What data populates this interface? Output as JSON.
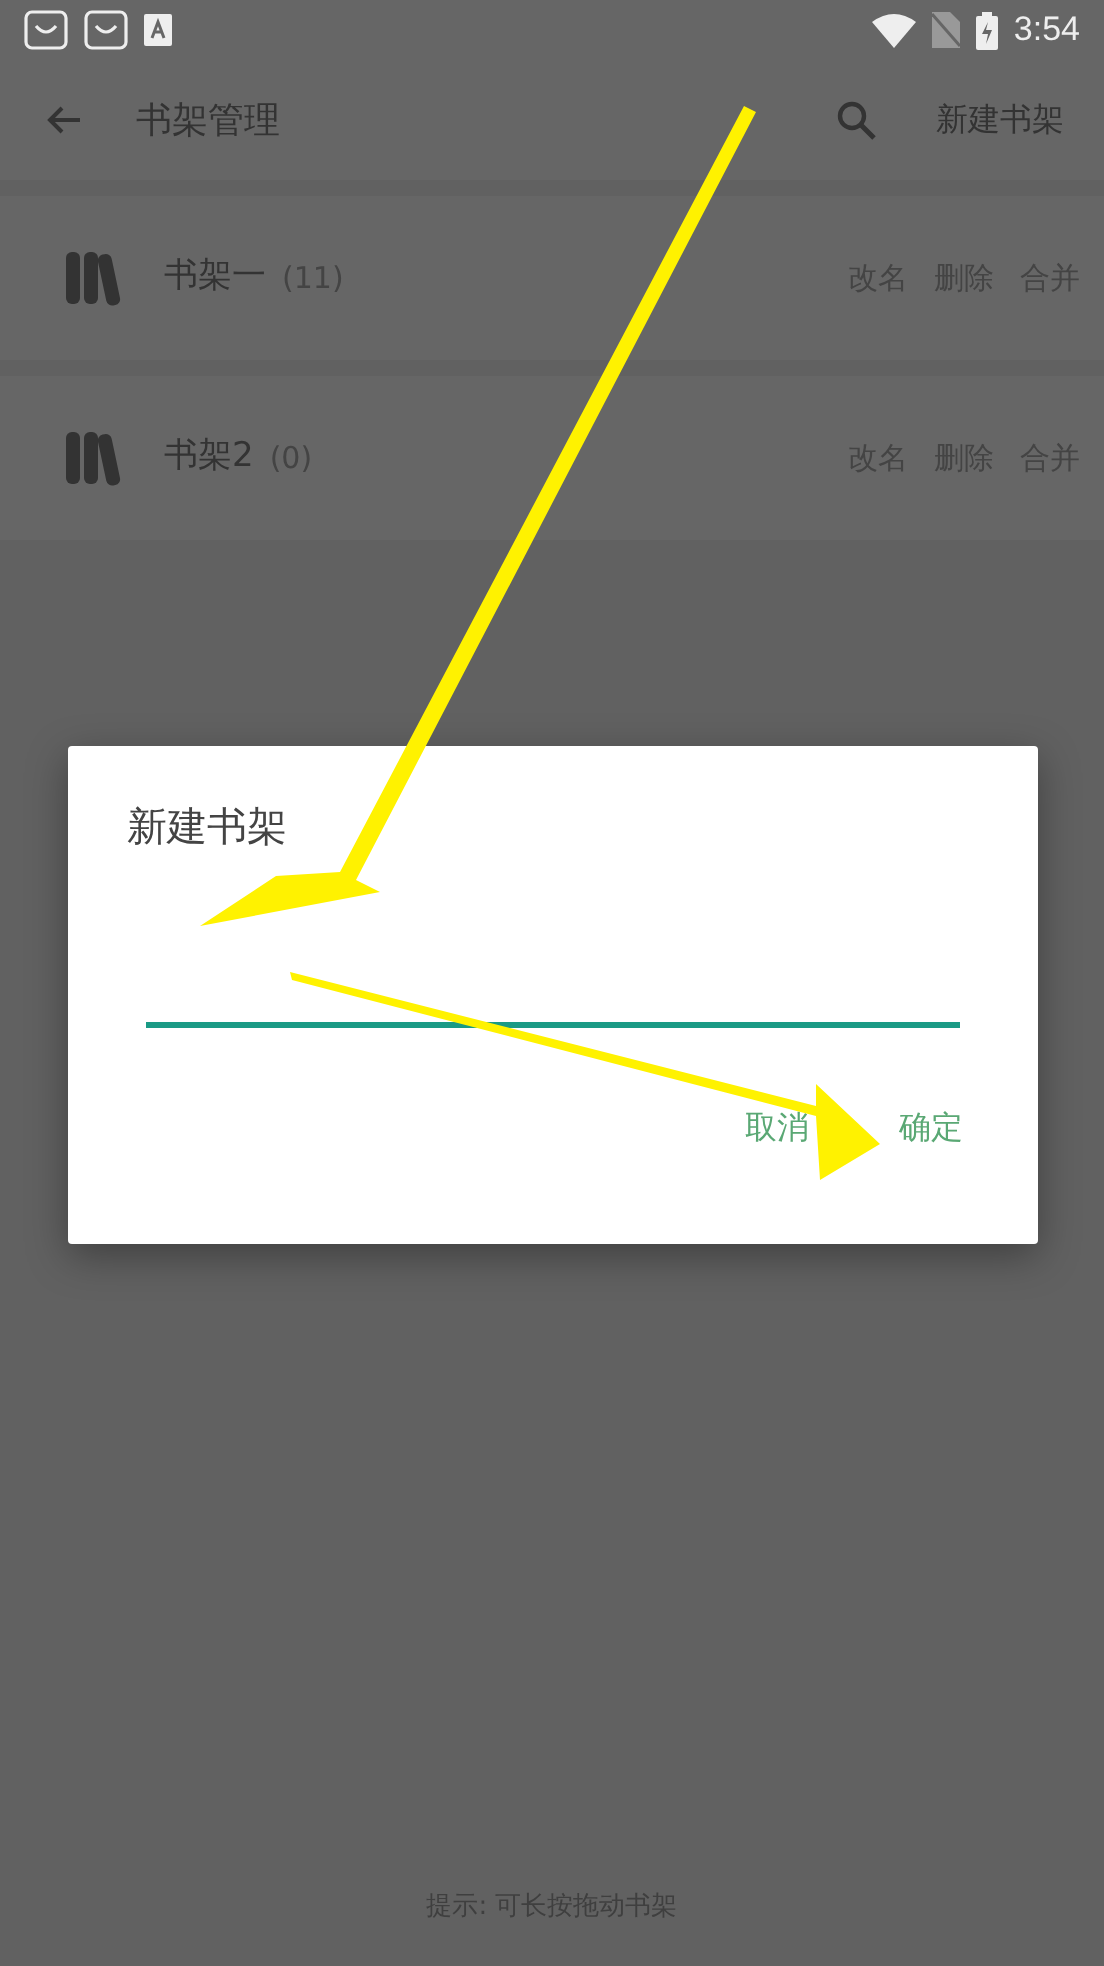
{
  "status_bar": {
    "time": "3:54"
  },
  "toolbar": {
    "title": "书架管理",
    "action": "新建书架"
  },
  "shelves": [
    {
      "name": "书架一",
      "count": "(11)",
      "actions": [
        "改名",
        "删除",
        "合并"
      ]
    },
    {
      "name": "书架2",
      "count": "(0)",
      "actions": [
        "改名",
        "删除",
        "合并"
      ]
    }
  ],
  "dialog": {
    "title": "新建书架",
    "field": {
      "focused": true
    },
    "buttons": [
      "取消",
      "确定"
    ]
  },
  "hint": "提示: 可长按拖动书架"
}
